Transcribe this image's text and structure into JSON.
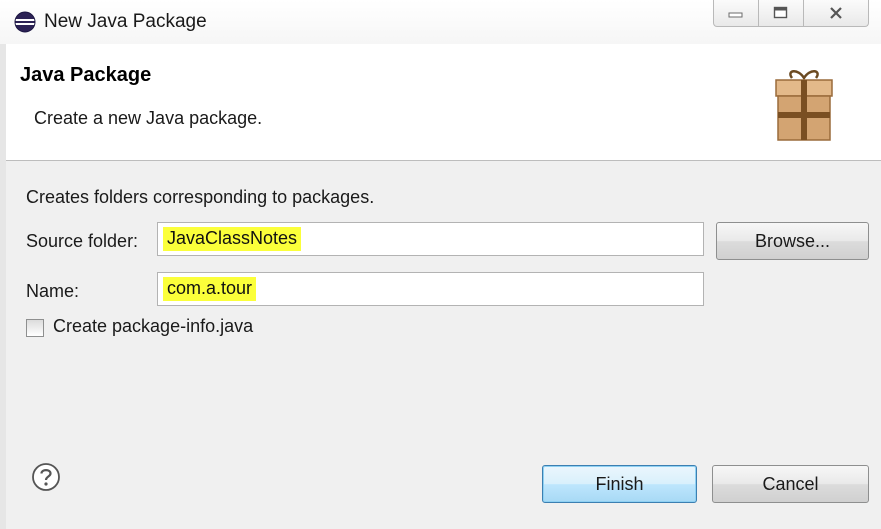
{
  "window": {
    "title": "New Java Package",
    "icons": {
      "app": "eclipse-icon",
      "minimize": "minimize-icon",
      "maximize": "maximize-icon",
      "close": "close-icon"
    }
  },
  "header": {
    "title": "Java Package",
    "subtitle": "Create a new Java package.",
    "icon": "package-icon"
  },
  "body": {
    "description": "Creates folders corresponding to packages.",
    "source_folder": {
      "label": "Source folder:",
      "value": "JavaClassNotes",
      "highlight_color": "#fbff3a"
    },
    "name": {
      "label": "Name:",
      "value": "com.a.tour",
      "highlight_color": "#fbff3a"
    },
    "browse_label": "Browse...",
    "create_package_info": {
      "label": "Create package-info.java",
      "checked": false
    }
  },
  "footer": {
    "help_icon": "help-icon",
    "finish_label": "Finish",
    "cancel_label": "Cancel"
  }
}
